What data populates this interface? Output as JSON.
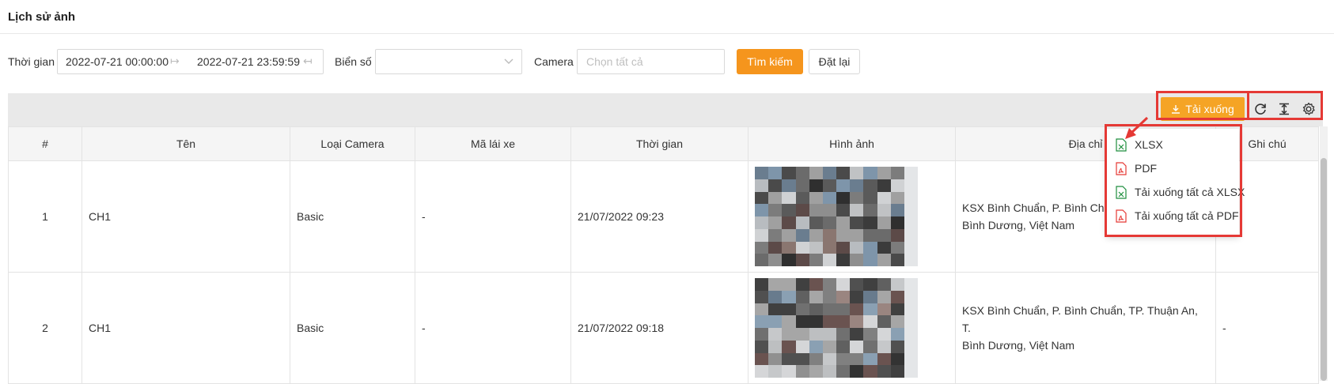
{
  "page": {
    "title": "Lịch sử ảnh"
  },
  "filters": {
    "time_label": "Thời gian",
    "time_start": "2022-07-21 00:00:00",
    "time_end": "2022-07-21 23:59:59",
    "plate_label": "Biển số",
    "plate_value": "",
    "camera_label": "Camera",
    "camera_placeholder": "Chọn tất cả",
    "search_label": "Tìm kiếm",
    "reset_label": "Đặt lại"
  },
  "toolbar": {
    "download_label": "Tải xuống",
    "icons": [
      "refresh-icon",
      "column-height-icon",
      "settings-icon"
    ]
  },
  "download_menu": {
    "items": [
      {
        "label": "XLSX",
        "icon": "xlsx-file-icon"
      },
      {
        "label": "PDF",
        "icon": "pdf-file-icon"
      },
      {
        "label": "Tải xuống tất cả XLSX",
        "icon": "xlsx-file-icon"
      },
      {
        "label": "Tải xuống tất cả PDF",
        "icon": "pdf-file-icon"
      }
    ]
  },
  "table": {
    "columns": [
      "#",
      "Tên",
      "Loại Camera",
      "Mã lái xe",
      "Thời gian",
      "Hình ảnh",
      "Địa chỉ",
      "Ghi chú"
    ],
    "rows": [
      {
        "num": "1",
        "name": "CH1",
        "camera_type": "Basic",
        "driver_code": "-",
        "time": "21/07/2022 09:23",
        "address_line1": "KSX Bình Chuẩn, P. Bình Chuẩ",
        "address_line2": "Bình Dương, Việt Nam",
        "note": ""
      },
      {
        "num": "2",
        "name": "CH1",
        "camera_type": "Basic",
        "driver_code": "-",
        "time": "21/07/2022 09:18",
        "address_line1": "KSX Bình Chuẩn, P. Bình Chuẩn, TP. Thuận An, T.",
        "address_line2": "Bình Dương, Việt Nam",
        "note": "-"
      }
    ]
  },
  "colors": {
    "accent": "#f5951d",
    "highlight": "#e53935",
    "xlsx": "#1e8e3e",
    "pdf": "#e53935"
  }
}
